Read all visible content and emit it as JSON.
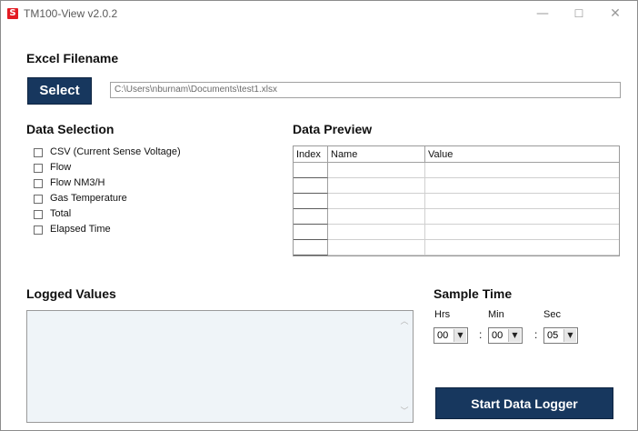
{
  "window": {
    "title": "TM100-View v2.0.2",
    "icon_letter": "S",
    "icon_color": "#e31b23",
    "controls": {
      "minimize": "—",
      "maximize": "☐",
      "close": "✕"
    }
  },
  "excel": {
    "heading": "Excel Filename",
    "select_label": "Select",
    "file_path": "C:\\Users\\nburnam\\Documents\\test1.xlsx"
  },
  "data_selection": {
    "heading": "Data Selection",
    "options": [
      {
        "label": "CSV (Current Sense Voltage)",
        "checked": false
      },
      {
        "label": "Flow",
        "checked": false
      },
      {
        "label": "Flow NM3/H",
        "checked": false
      },
      {
        "label": "Gas Temperature",
        "checked": false
      },
      {
        "label": "Total",
        "checked": false
      },
      {
        "label": "Elapsed Time",
        "checked": false
      }
    ]
  },
  "data_preview": {
    "heading": "Data Preview",
    "columns": [
      "Index",
      "Name",
      "Value"
    ],
    "rows": [
      [
        "",
        "",
        ""
      ],
      [
        "",
        "",
        ""
      ],
      [
        "",
        "",
        ""
      ],
      [
        "",
        "",
        ""
      ],
      [
        "",
        "",
        ""
      ],
      [
        "",
        "",
        ""
      ]
    ]
  },
  "logged_values": {
    "heading": "Logged Values",
    "content": ""
  },
  "sample_time": {
    "heading": "Sample Time",
    "hrs_label": "Hrs",
    "min_label": "Min",
    "sec_label": "Sec",
    "hrs": "00",
    "min": "00",
    "sec": "05",
    "separator": ":"
  },
  "start_button_label": "Start Data Logger",
  "colors": {
    "button_bg": "#17375e",
    "textarea_bg": "#eff4f8"
  }
}
